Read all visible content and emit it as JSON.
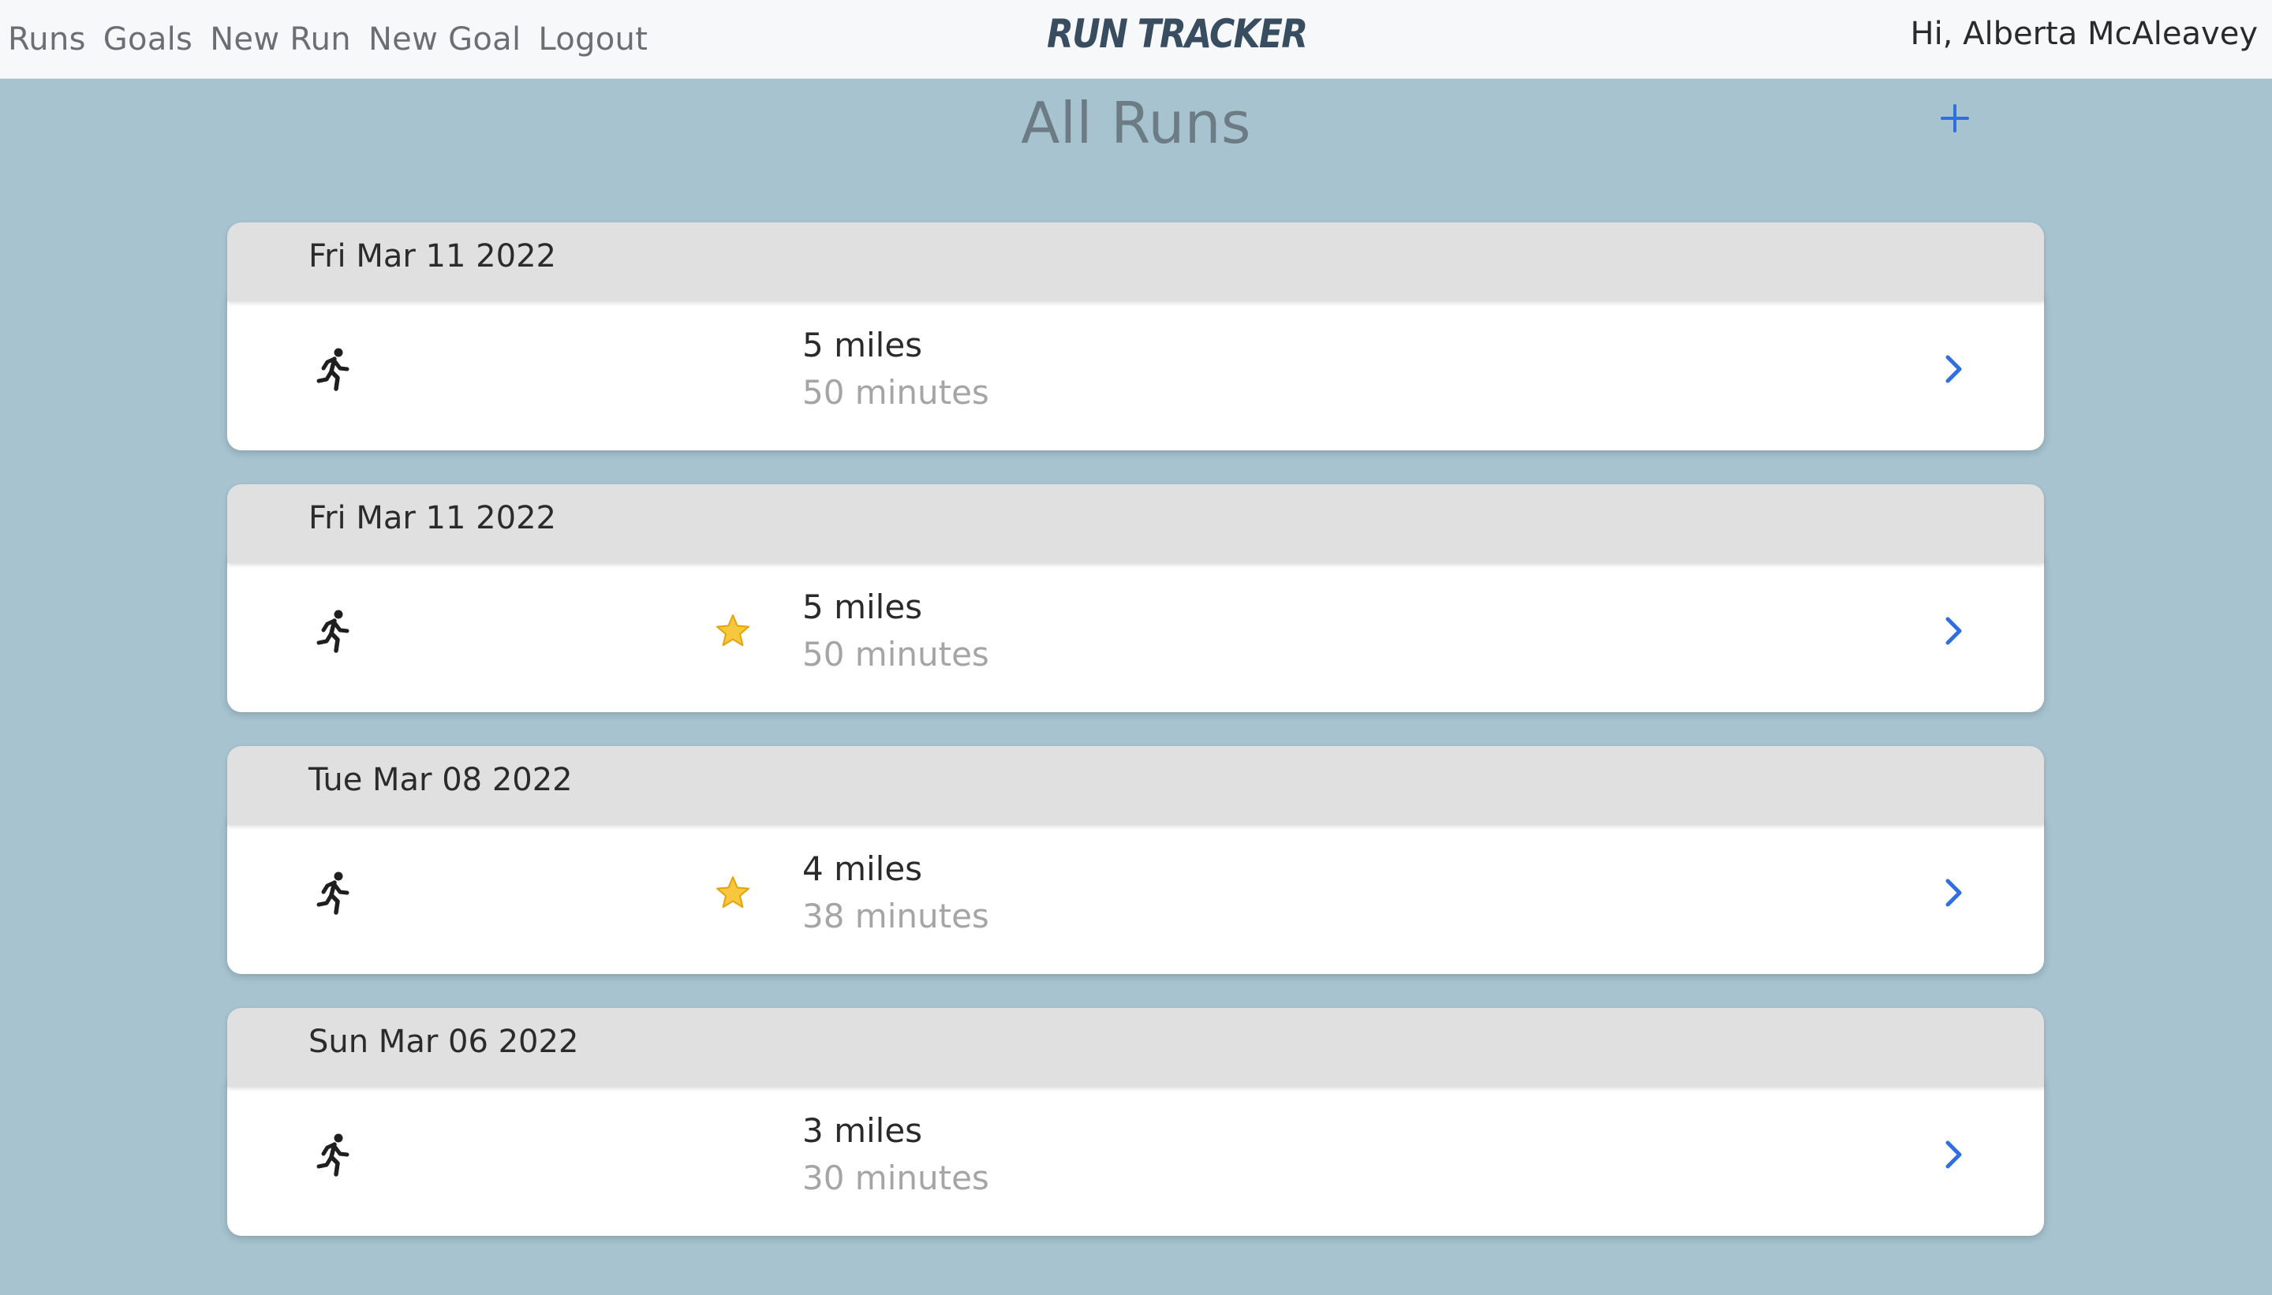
{
  "nav": {
    "links": [
      "Runs",
      "Goals",
      "New Run",
      "New Goal",
      "Logout"
    ],
    "brand": "RUN TRACKER",
    "greeting": "Hi, Alberta McAleavey"
  },
  "page": {
    "title": "All Runs",
    "add_icon": "plus-icon"
  },
  "runs": [
    {
      "date": "Fri Mar 11 2022",
      "distance": "5 miles",
      "duration": "50 minutes",
      "starred": false
    },
    {
      "date": "Fri Mar 11 2022",
      "distance": "5 miles",
      "duration": "50 minutes",
      "starred": true
    },
    {
      "date": "Tue Mar 08 2022",
      "distance": "4 miles",
      "duration": "38 minutes",
      "starred": true
    },
    {
      "date": "Sun Mar 06 2022",
      "distance": "3 miles",
      "duration": "30 minutes",
      "starred": false
    }
  ],
  "icons": {
    "runner": "runner-icon",
    "star": "star-icon",
    "chevron": "chevron-right-icon"
  },
  "colors": {
    "background": "#a6c3cf",
    "navbar": "#f7f8fa",
    "brand": "#394d60",
    "accent": "#2f6fe0",
    "date_header": "#e0e0e0",
    "card": "#ffffff",
    "star": "#f5c518"
  }
}
